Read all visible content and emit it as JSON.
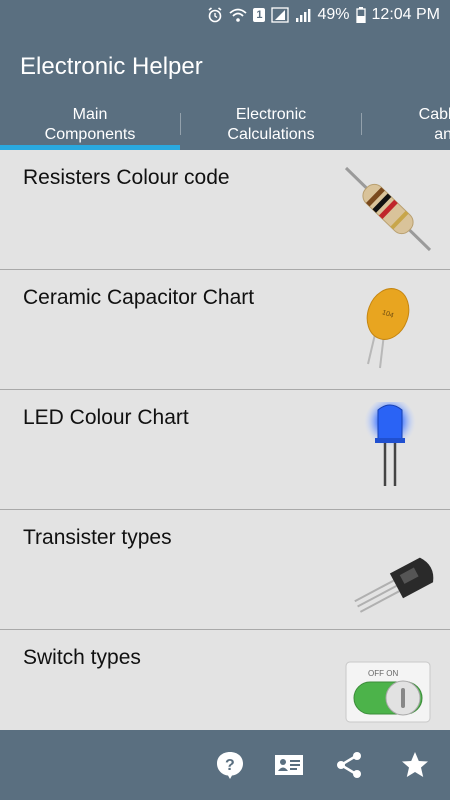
{
  "status_bar": {
    "time": "12:04 PM",
    "battery": "49%",
    "notification_count": "1"
  },
  "app": {
    "title": "Electronic Helper"
  },
  "tabs": [
    {
      "label": "Main\nComponents",
      "selected": true
    },
    {
      "label": "Electronic\nCalculations",
      "selected": false
    },
    {
      "label": "Cable Co\nand I",
      "selected": false
    }
  ],
  "items": [
    {
      "label": "Resisters Colour code",
      "icon": "resistor-icon"
    },
    {
      "label": "Ceramic Capacitor Chart",
      "icon": "capacitor-icon"
    },
    {
      "label": "LED Colour Chart",
      "icon": "led-icon"
    },
    {
      "label": "Transister types",
      "icon": "transistor-icon"
    },
    {
      "label": "Switch types",
      "icon": "switch-icon"
    }
  ],
  "bottom_bar": {
    "icons": [
      "help-icon",
      "contact-card-icon",
      "share-icon",
      "star-icon"
    ]
  },
  "colors": {
    "primary": "#5a6f80",
    "accent": "#2aa9df",
    "background": "#e3e3e3"
  }
}
